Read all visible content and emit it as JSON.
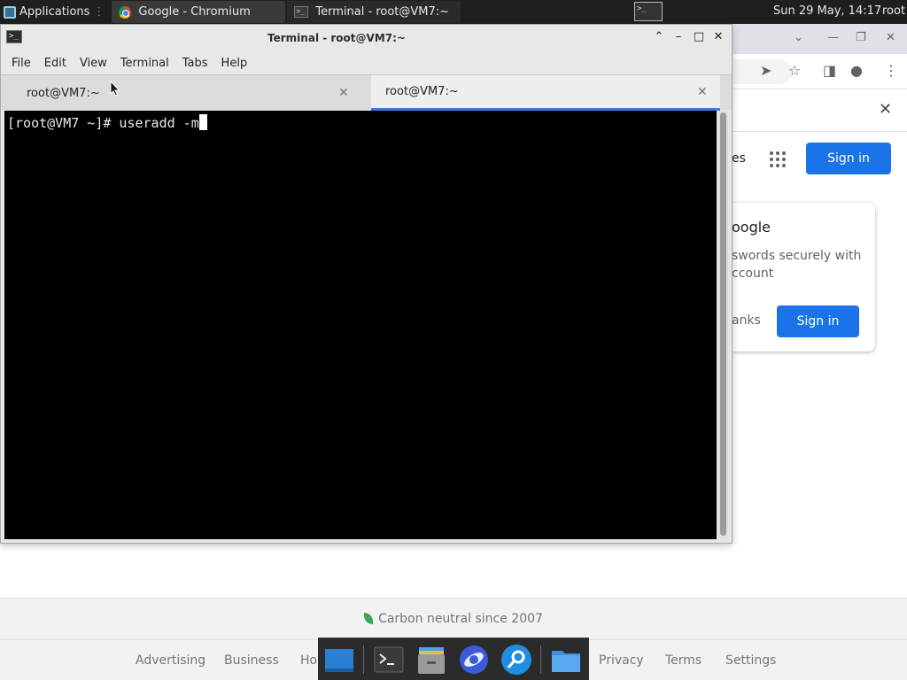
{
  "top_panel": {
    "applications_label": "Applications",
    "tasks": [
      {
        "label": "Google - Chromium",
        "icon": "chromium-icon"
      },
      {
        "label": "Terminal - root@VM7:~",
        "icon": "terminal-icon"
      }
    ],
    "clock": "Sun 29 May, 14:17",
    "user": "root"
  },
  "terminal": {
    "title": "Terminal - root@VM7:~",
    "menu": [
      "File",
      "Edit",
      "View",
      "Terminal",
      "Tabs",
      "Help"
    ],
    "tabs": [
      {
        "label": "root@VM7:~",
        "active": false
      },
      {
        "label": "root@VM7:~",
        "active": true
      }
    ],
    "prompt_line": "[root@VM7 ~]# useradd -m"
  },
  "browser": {
    "partial_header_link": "es",
    "sign_in_label": "Sign in",
    "promo": {
      "title_partial": "oogle",
      "text_partial": "swords securely with\nccount",
      "no_thanks_partial": "anks",
      "sign_in_label": "Sign in"
    },
    "footer": {
      "carbon": "Carbon neutral since 2007",
      "links": [
        "Advertising",
        "Business",
        "Ho",
        "Privacy",
        "Terms",
        "Settings"
      ]
    }
  },
  "colors": {
    "accent": "#1a73e8",
    "terminal_tab_indicator": "#3d7ccd",
    "panel_bg": "#1f1f1f"
  }
}
